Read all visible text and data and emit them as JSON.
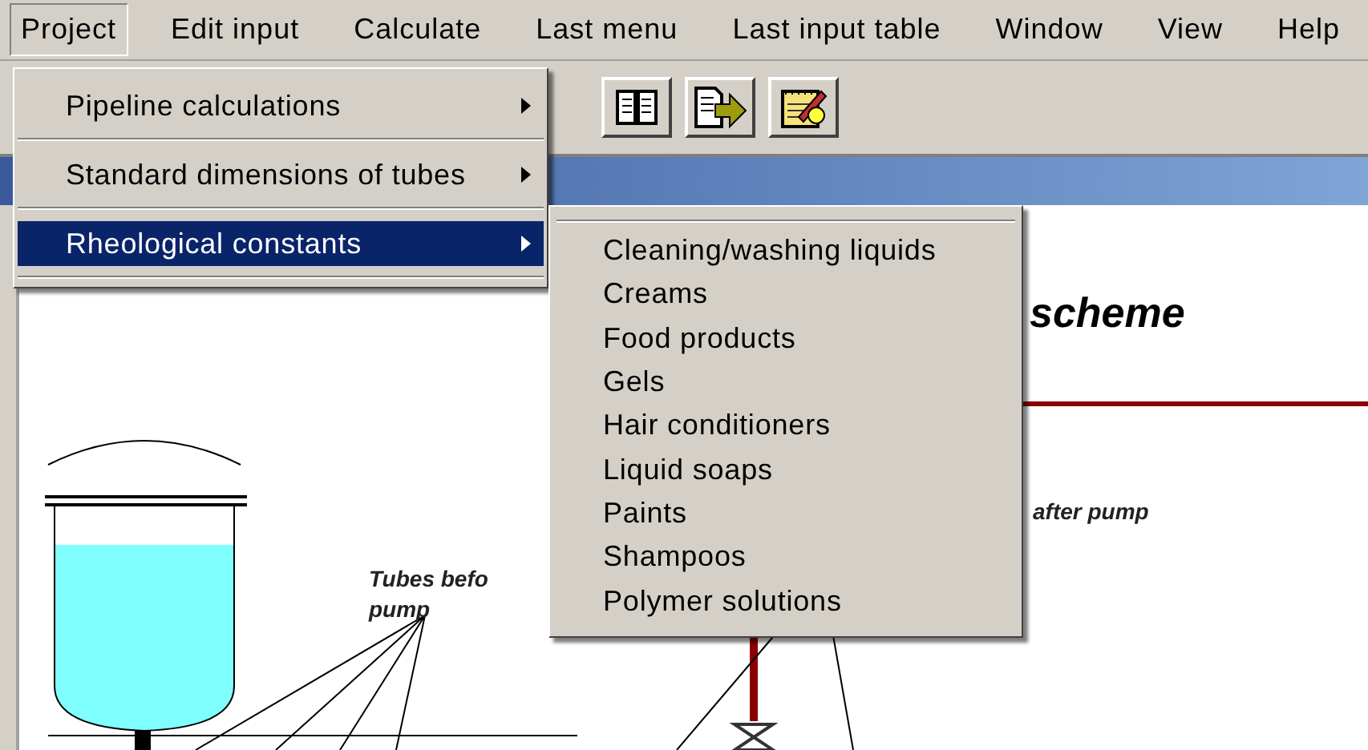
{
  "menu_bar": [
    {
      "label": "Project",
      "selected": true
    },
    {
      "label": "Edit input",
      "selected": false
    },
    {
      "label": "Calculate",
      "selected": false
    },
    {
      "label": "Last menu",
      "selected": false
    },
    {
      "label": "Last input table",
      "selected": false
    },
    {
      "label": "Window",
      "selected": false
    },
    {
      "label": "View",
      "selected": false
    },
    {
      "label": "Help",
      "selected": false
    }
  ],
  "project_menu": [
    {
      "label": "Pipeline calculations",
      "selected": false,
      "has_submenu": true
    },
    {
      "label": "Standard dimensions of tubes",
      "selected": false,
      "has_submenu": true
    },
    {
      "label": "Rheological constants",
      "selected": true,
      "has_submenu": true
    }
  ],
  "rheological_submenu": [
    {
      "label": "Cleaning/washing liquids"
    },
    {
      "label": "Creams"
    },
    {
      "label": "Food products"
    },
    {
      "label": "Gels"
    },
    {
      "label": "Hair conditioners"
    },
    {
      "label": "Liquid soaps"
    },
    {
      "label": "Paints"
    },
    {
      "label": "Shampoos"
    },
    {
      "label": "Polymer solutions"
    }
  ],
  "document": {
    "title_fragment": "scheme",
    "labels": [
      {
        "text": "Tubes befo",
        "kind": "before"
      },
      {
        "text": "pump",
        "kind": "before"
      },
      {
        "text": "after pump",
        "kind": "after"
      }
    ]
  }
}
